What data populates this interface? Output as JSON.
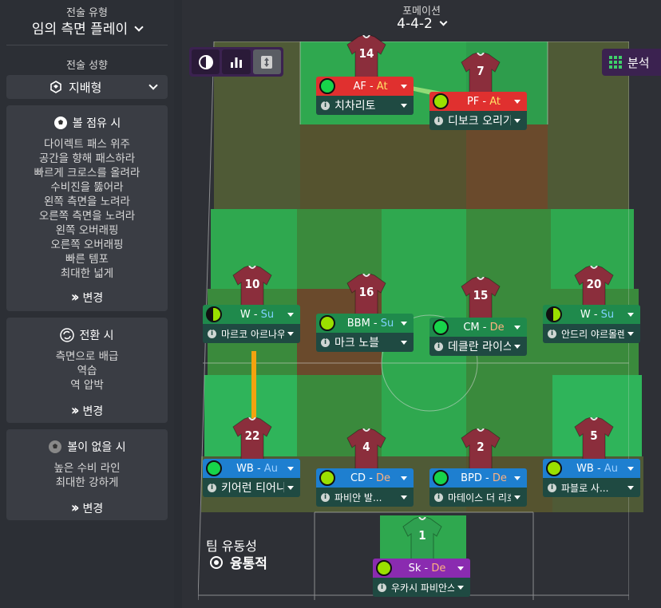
{
  "sidebar": {
    "style_label": "전술 유형",
    "style_value": "임의 측면 플레이",
    "mentality_label": "전술 성향",
    "mentality_value": "지배형",
    "in_possession": {
      "title": "볼 점유 시",
      "items": [
        "다이렉트 패스 위주",
        "공간을 향해 패스하라",
        "빠르게 크로스를 올려라",
        "수비진을 뚫어라",
        "왼쪽 측면을 노려라",
        "오른쪽 측면을 노려라",
        "왼쪽 오버래핑",
        "오른쪽 오버래핑",
        "빠른 템포",
        "최대한 넓게"
      ],
      "change": "변경"
    },
    "transition": {
      "title": "전환 시",
      "items": [
        "측면으로 배급",
        "역습",
        "역 압박"
      ],
      "change": "변경"
    },
    "out_of_possession": {
      "title": "볼이 없을 시",
      "items": [
        "높은 수비 라인",
        "최대한 강하게"
      ],
      "change": "변경"
    }
  },
  "formation": {
    "label": "포메이션",
    "value": "4-4-2"
  },
  "analysis_label": "분석",
  "team_fluidity": {
    "label": "팀 유동성",
    "value": "융통적"
  },
  "players": [
    {
      "number": "14",
      "role": "AF",
      "duty": "At",
      "name": "치차리토",
      "role_color": "#e0302f"
    },
    {
      "number": "7",
      "role": "PF",
      "duty": "At",
      "name": "디보크 오리기",
      "role_color": "#e0302f"
    },
    {
      "number": "10",
      "role": "W",
      "duty": "Su",
      "name": "마르코 아르나우토비치",
      "role_color": "#1f8a4c"
    },
    {
      "number": "16",
      "role": "BBM",
      "duty": "Su",
      "name": "마크 노블",
      "role_color": "#1f8a4c"
    },
    {
      "number": "15",
      "role": "CM",
      "duty": "De",
      "name": "데클란 라이스",
      "role_color": "#1f8a4c"
    },
    {
      "number": "20",
      "role": "W",
      "duty": "Su",
      "name": "안드리 야르몰렌코",
      "role_color": "#1f8a4c"
    },
    {
      "number": "22",
      "role": "WB",
      "duty": "Au",
      "name": "키어런 티어니",
      "role_color": "#1e7fd0"
    },
    {
      "number": "4",
      "role": "CD",
      "duty": "De",
      "name": "파비안 발...",
      "role_color": "#1e7fd0"
    },
    {
      "number": "2",
      "role": "BPD",
      "duty": "De",
      "name": "마테이스 더 리흐트",
      "role_color": "#1e7fd0"
    },
    {
      "number": "5",
      "role": "WB",
      "duty": "Au",
      "name": "파블로 사...",
      "role_color": "#1e7fd0"
    },
    {
      "number": "1",
      "role": "Sk",
      "duty": "De",
      "name": "우카시 파비안스키",
      "role_color": "#8a2bb0"
    }
  ],
  "colors": {
    "shirt": "#8b2e3c",
    "gk_shirt": "#2fa050",
    "green_bright": "#2fb45a",
    "green_mid": "#3d8a3d",
    "olive": "#5a5a2a",
    "brown": "#6b4a2a",
    "purple_accent": "#3b2250"
  }
}
